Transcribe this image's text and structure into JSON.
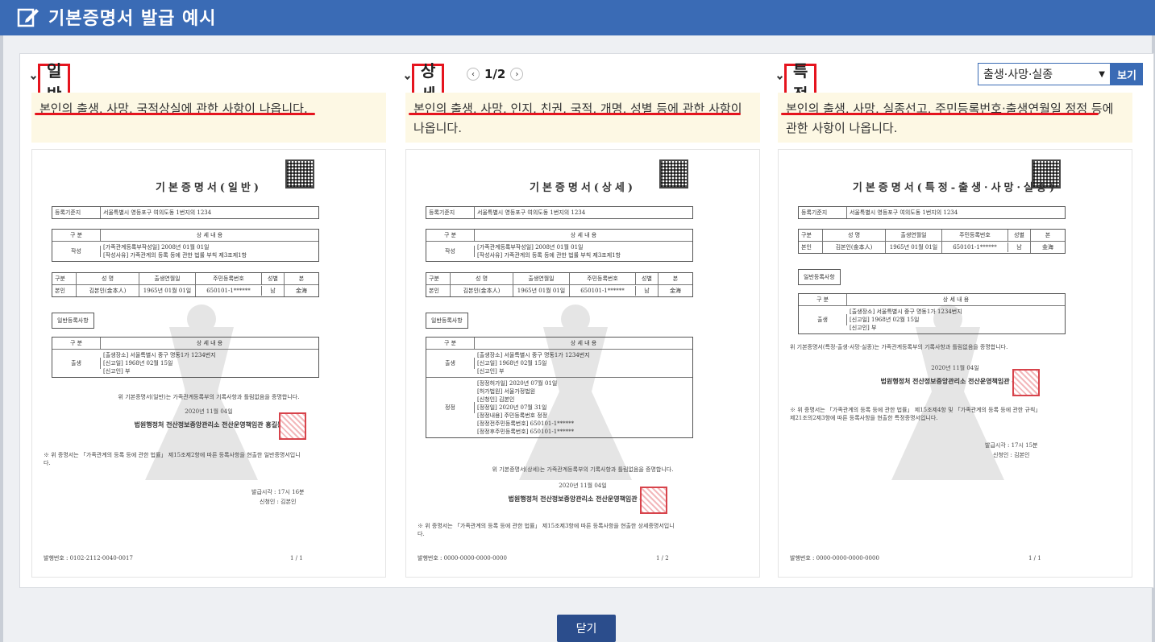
{
  "header": {
    "title": "기본증명서 발급 예시"
  },
  "columns": [
    {
      "label": "일반",
      "desc": "본인의 출생, 사망, 국적상실에 관한 사항이 나옵니다.",
      "doc": {
        "title": "기본증명서(일반)",
        "reg_label": "등록기준지",
        "reg_value": "서울특별시 영등포구 여의도동 1번지의 1234",
        "sec_hdr": [
          "구 분",
          "상 세 내 용"
        ],
        "sec_row": [
          "작성",
          "[가족관계등록부작성일]  2008년 01월 01일",
          "[작성사유]  가족관계의 등록 등에 관한 법률 부칙 제3조제1항"
        ],
        "person_hdr": [
          "구분",
          "성 명",
          "출생연월일",
          "주민등록번호",
          "성별",
          "본"
        ],
        "person_row": [
          "본인",
          "김본인(金本人)",
          "1965년 01월 01일",
          "650101-1******",
          "남",
          "金海"
        ],
        "general_tag": "일반등록사항",
        "birth_hdr": [
          "구 분",
          "상 세 내 용"
        ],
        "birth_row": [
          "출생",
          "[출생장소]  서울특별시 중구 명동1가 1234번지",
          "[신고일]  1968년 02월 15일",
          "[신고인]  부"
        ],
        "confirm": "위 기본증명서(일반)는 가족관계등록부의 기록사항과 틀림없음을 증명합니다.",
        "date": "2020년 11월 04일",
        "signer": "법원행정처 전산정보중앙관리소 전산운영책임관 홍길동",
        "note": "※ 위 증명서는 「가족관계의 등록 등에 관한 법률」 제15조제2항에 따른 등록사항을 현출한 일반증명서입니다.",
        "issue_time": "발급시각 : 17시 16분",
        "applicant": "신청인 : 김본인",
        "issue_no": "발행번호 : 0102-2112-0040-0017",
        "page": "1 / 1"
      }
    },
    {
      "label": "상세",
      "pager": "1/2",
      "desc": "본인의 출생, 사망, 인지, 친권, 국적, 개명, 성별 등에 관한 사항이 나옵니다.",
      "doc": {
        "title": "기본증명서(상세)",
        "reg_label": "등록기준지",
        "reg_value": "서울특별시 영등포구 여의도동 1번지의 1234",
        "sec_hdr": [
          "구 분",
          "상 세 내 용"
        ],
        "sec_row": [
          "작성",
          "[가족관계등록부작성일]  2008년 01월 01일",
          "[작성사유]  가족관계의 등록 등에 관한 법률 부칙 제3조제1항"
        ],
        "person_hdr": [
          "구분",
          "성 명",
          "출생연월일",
          "주민등록번호",
          "성별",
          "본"
        ],
        "person_row": [
          "본인",
          "김본인(金本人)",
          "1965년 01월 01일",
          "650101-1******",
          "남",
          "金海"
        ],
        "general_tag": "일반등록사항",
        "birth_hdr": [
          "구 분",
          "상 세 내 용"
        ],
        "birth_row": [
          "출생",
          "[출생장소]  서울특별시 중구 명동1가 1234번지",
          "[신고일]  1968년 02월 15일",
          "[신고인]  부"
        ],
        "fix_row": [
          "정정",
          "[정정허가일]  2020년 07월 01일",
          "[허가법원]  서울가정법원",
          "[신청인]  김본인",
          "[정정일]  2020년 07월 31일",
          "[정정내용]  주민등록번호 정정",
          "[정정전주민등록번호]  650101-1******",
          "[정정후주민등록번호]  650101-1******"
        ],
        "confirm": "위 기본증명서(상세)는 가족관계등록부의 기록사항과 틀림없음을 증명합니다.",
        "date": "2020년 11월 04일",
        "signer": "법원행정처 전산정보중앙관리소 전산운영책임관 홍길동",
        "note": "※ 위 증명서는 「가족관계의 등록 등에 관한 법률」 제15조제3항에 따른 등록사항을 현출한 상세증명서입니다.",
        "issue_no": "발행번호 : 0000-0000-0000-0000",
        "page": "1 / 2"
      }
    },
    {
      "label": "특정",
      "desc": "본인의 출생, 사망, 실종선고, 주민등록번호·출생연월일 정정 등에 관한 사항이 나옵니다.",
      "doc": {
        "title": "기본증명서(특정-출생·사망·실종)",
        "reg_label": "등록기준지",
        "reg_value": "서울특별시 영등포구 여의도동 1번지의 1234",
        "person_hdr": [
          "구분",
          "성 명",
          "출생연월일",
          "주민등록번호",
          "성별",
          "본"
        ],
        "person_row": [
          "본인",
          "김본인(金本人)",
          "1965년 01월 01일",
          "650101-1******",
          "남",
          "金海"
        ],
        "general_tag": "일반등록사항",
        "birth_hdr": [
          "구 분",
          "상 세 내 용"
        ],
        "birth_row": [
          "출생",
          "[출생장소]  서울특별시 중구 명동1가 1234번지",
          "[신고일]  1968년 02월 15일",
          "[신고인]  부"
        ],
        "confirm": "위 기본증명서(특정-출생·사망·실종)는 가족관계등록부의 기록사항과 틀림없음을 증명합니다.",
        "date": "2020년 11월 04일",
        "signer": "법원행정처 전산정보중앙관리소 전산운영책임관 홍길동",
        "note": "※ 위 증명서는 「가족관계의 등록 등에 관한 법률」 제15조제4항 및 「가족관계의 등록 등에 관한 규칙」 제21조의2제3항에 따른 등록사항을 현출한 특정증명서입니다.",
        "issue_time": "발급시각 : 17시 15분",
        "applicant": "신청인 : 김본인",
        "issue_no": "발행번호 : 0000-0000-0000-0000",
        "page": "1 / 1"
      }
    }
  ],
  "select": {
    "value": "출생·사망·실종",
    "view_label": "보기"
  },
  "footer": {
    "close_label": "닫기"
  },
  "colors": {
    "header": "#3a6bb5",
    "highlight": "#e5141e",
    "desc_bg": "#fdf8e4",
    "close_btn": "#2b4d8c"
  }
}
